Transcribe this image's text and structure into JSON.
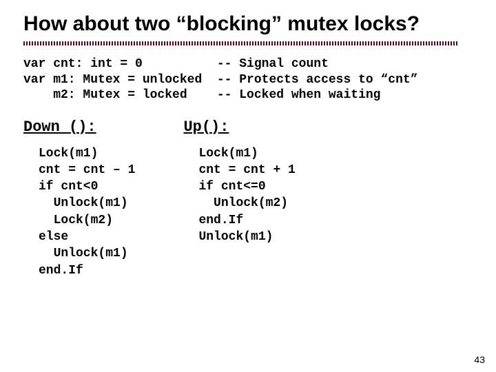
{
  "title": "How about two “blocking” mutex locks?",
  "decl": "var cnt: int = 0          -- Signal count\nvar m1: Mutex = unlocked  -- Protects access to “cnt”\n    m2: Mutex = locked    -- Locked when waiting",
  "down": {
    "name": "Down ():",
    "code": "Lock(m1)\ncnt = cnt – 1\nif cnt<0\n  Unlock(m1)\n  Lock(m2)\nelse\n  Unlock(m1)\nend.If"
  },
  "up": {
    "name": "Up():",
    "code": "Lock(m1)\ncnt = cnt + 1\nif cnt<=0\n  Unlock(m2)\nend.If\nUnlock(m1)"
  },
  "page_number": "43"
}
